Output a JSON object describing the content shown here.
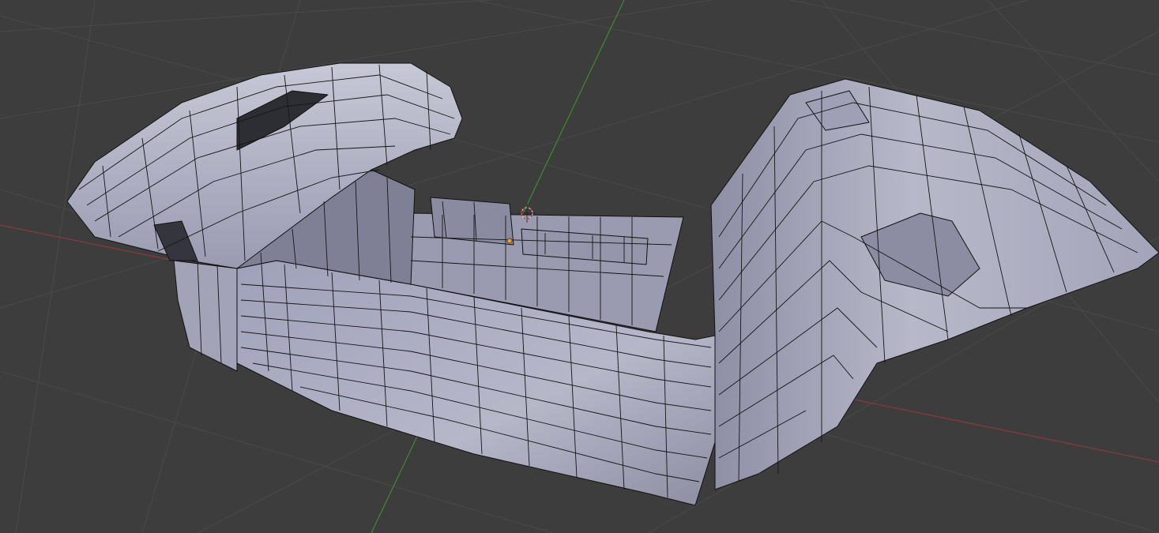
{
  "viewport": {
    "background": "#3d3d3d",
    "grid_color": "#494949",
    "axis_x_color": "#8a3a3a",
    "axis_y_color": "#3f8a2e"
  },
  "model": {
    "face_color": "#a9aabf",
    "face_dark_color": "#8f90a6",
    "face_light_color": "#c9cad8",
    "wire_color": "#111111"
  },
  "icons": {
    "cursor": "3d-cursor-icon",
    "origin": "object-origin-icon"
  }
}
